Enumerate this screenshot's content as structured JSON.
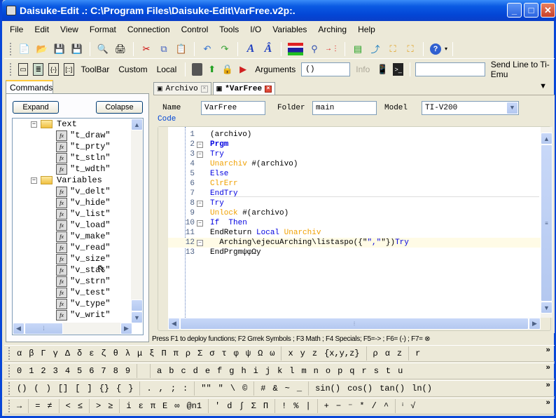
{
  "window": {
    "title": "Daisuke-Edit .: C:\\Program Files\\Daisuke-Edit\\VarFree.v2p:.",
    "controls": {
      "minimize": "_",
      "maximize": "□",
      "close": "✕"
    }
  },
  "menu": [
    "File",
    "Edit",
    "View",
    "Format",
    "Connection",
    "Control",
    "Tools",
    "I/O",
    "Variables",
    "Arching",
    "Help"
  ],
  "toolbar1": {
    "icons": [
      "new-file-icon",
      "open-folder-icon",
      "save-icon",
      "save-all-icon",
      "print-preview-icon",
      "print-icon",
      "cut-icon",
      "copy-icon",
      "paste-icon",
      "undo-icon",
      "redo-icon",
      "font-icon",
      "font-size-icon",
      "convert-icon",
      "find-replace-icon",
      "numbering-icon",
      "deploy-icon",
      "import-icon",
      "tree-icon",
      "tree-alt-icon",
      "help-icon"
    ]
  },
  "toolbar2": {
    "toolbar_label": "ToolBar",
    "custom_label": "Custom",
    "local_label": "Local",
    "arguments_label": "Arguments",
    "arguments_value": "()",
    "info_label": "Info",
    "send_line_value": "",
    "send_line_label": "Send Line to Ti-Emu"
  },
  "left_panel": {
    "tab": "Commands",
    "expand": "Expand",
    "collapse": "Colapse",
    "tree": [
      {
        "type": "folder",
        "label": "Text"
      },
      {
        "type": "func",
        "label": "\"t_draw\""
      },
      {
        "type": "func",
        "label": "\"t_prty\""
      },
      {
        "type": "func",
        "label": "\"t_stln\""
      },
      {
        "type": "func",
        "label": "\"t_wdth\""
      },
      {
        "type": "folder",
        "label": "Variables"
      },
      {
        "type": "func",
        "label": "\"v_delt\""
      },
      {
        "type": "func",
        "label": "\"v_hide\""
      },
      {
        "type": "func",
        "label": "\"v_list\""
      },
      {
        "type": "func",
        "label": "\"v_load\""
      },
      {
        "type": "func",
        "label": "\"v_make\""
      },
      {
        "type": "func",
        "label": "\"v_read\""
      },
      {
        "type": "func",
        "label": "\"v_size\""
      },
      {
        "type": "func",
        "label": "\"v_stat\""
      },
      {
        "type": "func",
        "label": "\"v_strn\""
      },
      {
        "type": "func",
        "label": "\"v_test\""
      },
      {
        "type": "func",
        "label": "\"v_type\""
      },
      {
        "type": "func",
        "label": "\"v_writ\""
      }
    ]
  },
  "doc_tabs": [
    {
      "label": "Archivo",
      "active": false
    },
    {
      "label": "*VarFree",
      "active": true
    }
  ],
  "editor": {
    "name_label": "Name",
    "name_value": "VarFree",
    "folder_label": "Folder",
    "folder_value": "main",
    "model_label": "Model",
    "model_value": "TI-V200",
    "code_label": "Code",
    "lines": [
      {
        "n": "1",
        "fold": "",
        "html": "(archivo)"
      },
      {
        "n": "2",
        "fold": "-",
        "html": "<span class='kwb'>Prgm</span>"
      },
      {
        "n": "3",
        "fold": "-",
        "html": "<span class='kw'>Try</span>"
      },
      {
        "n": "4",
        "fold": "",
        "html": "<span class='or'>Unarchiv</span> #(archivo)"
      },
      {
        "n": "5",
        "fold": "",
        "html": "<span class='kw'>Else</span>"
      },
      {
        "n": "6",
        "fold": "",
        "html": "<span class='or'>ClrErr</span>"
      },
      {
        "n": "7",
        "fold": "",
        "html": "<span class='kw'>EndTry</span>"
      },
      {
        "n": "8",
        "fold": "-",
        "html": "<span class='kw'>Try</span>"
      },
      {
        "n": "9",
        "fold": "",
        "html": "<span class='or'>Unlock</span> #(archivo)"
      },
      {
        "n": "10",
        "fold": "-",
        "html": "<span class='kw'>If</span>  <span class='kw'>Then</span>"
      },
      {
        "n": "11",
        "fold": "",
        "html": "EndReturn <span class='kw'>Local</span> <span class='or'>Unarchiv</span>"
      },
      {
        "n": "12",
        "fold": "-",
        "html": "  Arching\\ejecuArching\\listaspo({\"<span class='kw'>\",\"</span>\"})<span class='kw'>Try</span>",
        "highlight": true
      },
      {
        "n": "13",
        "fold": "",
        "html": "EndPrgmψφΩy"
      }
    ]
  },
  "status": "Press F1 to deploy functions; F2 Grrek Symbols ; F3 Math ; F4 Specials; F5=-> ; F6= (-) ; F7= ⊗",
  "symbol_bars": [
    [
      [
        "α",
        "β",
        "Γ",
        "γ",
        "Δ",
        "δ",
        "ε",
        "ζ",
        "θ",
        "λ",
        "μ",
        "ξ",
        "Π",
        "π",
        "ρ",
        "Σ",
        "σ",
        "τ",
        "φ",
        "ψ",
        "Ω",
        "ω"
      ],
      [
        "x",
        "y",
        "z",
        "{x,y,z}"
      ],
      [
        "ρ",
        "α",
        "z"
      ],
      [
        "r"
      ]
    ],
    [
      [
        "0",
        "1",
        "2",
        "3",
        "4",
        "5",
        "6",
        "7",
        "8",
        "9"
      ],
      [
        "  "
      ],
      [
        "a",
        "b",
        "c",
        "d",
        "e",
        "f",
        "g",
        "h",
        "i",
        "j",
        "k",
        "l",
        "m",
        "n",
        "o",
        "p",
        "q",
        "r",
        "s",
        "t",
        "u"
      ]
    ],
    [
      [
        "()",
        "(",
        ")",
        "[]",
        "[",
        "]",
        "{}",
        "{",
        "}"
      ],
      [
        ".",
        ",",
        ";",
        ":"
      ],
      [
        "\"\"",
        "\"",
        "\\",
        "©"
      ],
      [
        "#",
        "&",
        "~",
        "_"
      ],
      [
        "sin()",
        "cos()",
        "tan()",
        "ln()"
      ]
    ],
    [
      [
        "→"
      ],
      [
        "=",
        "≠"
      ],
      [
        "<",
        "≤"
      ],
      [
        ">",
        "≥"
      ],
      [
        "i",
        "ε",
        "π",
        "E",
        "∞",
        "@n1"
      ],
      [
        "'",
        "d",
        "∫",
        "Σ",
        "Π"
      ],
      [
        "!",
        "%",
        "|"
      ],
      [
        "+",
        "−",
        "⁻",
        "*",
        "/",
        "^"
      ],
      [
        "ⁱ",
        "√"
      ]
    ]
  ],
  "more_label": "»"
}
